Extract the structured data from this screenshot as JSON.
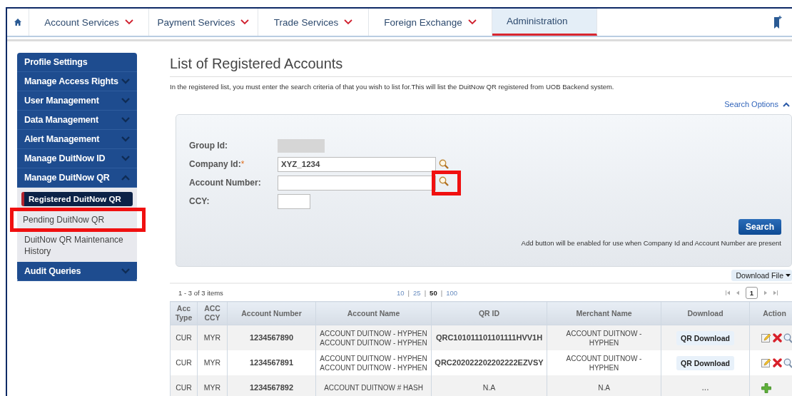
{
  "nav": {
    "items": [
      {
        "label": "Account Services",
        "has_menu": true,
        "selected": false
      },
      {
        "label": "Payment Services",
        "has_menu": true,
        "selected": false
      },
      {
        "label": "Trade Services",
        "has_menu": true,
        "selected": false
      },
      {
        "label": "Foreign Exchange",
        "has_menu": true,
        "selected": false
      },
      {
        "label": "Administration",
        "has_menu": false,
        "selected": true
      }
    ]
  },
  "sidebar": {
    "items": [
      {
        "label": "Profile Settings",
        "kind": "link"
      },
      {
        "label": "Manage Access Rights",
        "kind": "group"
      },
      {
        "label": "User Management",
        "kind": "group"
      },
      {
        "label": "Data Management",
        "kind": "group"
      },
      {
        "label": "Alert Management",
        "kind": "group"
      },
      {
        "label": "Manage DuitNow ID",
        "kind": "group"
      },
      {
        "label": "Manage DuitNow QR",
        "kind": "group",
        "expanded": true,
        "children": [
          {
            "label": "Registered DuitNow QR",
            "selected": true,
            "highlighted": false
          },
          {
            "label": "Pending DuitNow QR",
            "selected": false,
            "highlighted": true
          },
          {
            "label": "DuitNow QR Maintenance History",
            "selected": false,
            "highlighted": false
          }
        ]
      },
      {
        "label": "Audit Queries",
        "kind": "group"
      }
    ]
  },
  "page": {
    "title": "List of Registered Accounts",
    "description": "In the registered list, you must enter the search criteria of that you wish to list for.This will list the DuitNow QR registered from UOB Backend system.",
    "search_options": {
      "label": "Search Options",
      "expanded": true
    }
  },
  "search_form": {
    "fields": [
      {
        "label": "Group Id:",
        "kind": "locked"
      },
      {
        "label": "Company Id:",
        "required": true,
        "kind": "text",
        "value": "XYZ_1234",
        "lookup": {
          "highlighted": false
        }
      },
      {
        "label": "Account Number:",
        "kind": "text",
        "lookup": {
          "highlighted": true
        }
      },
      {
        "label": "CCY:",
        "kind": "short"
      }
    ],
    "required_mark": "*",
    "search_button": "Search",
    "note": "Add button will be enabled for use when Company Id and Account Number are present"
  },
  "download_file": "Download File",
  "pagination": {
    "summary": "1 - 3 of 3 items",
    "separator": "|",
    "page_sizes": [
      {
        "label": "10",
        "selected": false
      },
      {
        "label": "25",
        "selected": false
      },
      {
        "label": "50",
        "selected": true
      },
      {
        "label": "100",
        "selected": false
      }
    ],
    "pages": [
      {
        "label": "1",
        "selected": true
      }
    ]
  },
  "table": {
    "columns": [
      [
        "Acc",
        "Type"
      ],
      [
        "ACC",
        "CCY"
      ],
      [
        "Account Number"
      ],
      [
        "Account Name"
      ],
      [
        "QR ID"
      ],
      [
        "Merchant Name"
      ],
      [
        "Download"
      ],
      [
        "Action"
      ]
    ],
    "rows": [
      {
        "acc_type": "CUR",
        "acc_ccy": "MYR",
        "account_number": "1234567890",
        "account_name": [
          "ACCOUNT DUITNOW - HYPHEN",
          "ACCOUNT DUITNOW - HYPHEN"
        ],
        "qr_id": "QRC101011101101111HVV1H",
        "merchant_name": [
          "ACCOUNT DUITNOW -",
          "HYPHEN"
        ],
        "download": {
          "kind": "button",
          "label": "QR Download"
        },
        "actions": [
          {
            "kind": "edit"
          },
          {
            "kind": "delete"
          },
          {
            "kind": "view"
          }
        ]
      },
      {
        "acc_type": "CUR",
        "acc_ccy": "MYR",
        "account_number": "1234567891",
        "account_name": [
          "ACCOUNT DUITNOW - HYPHEN",
          "ACCOUNT DUITNOW - HYPHEN"
        ],
        "qr_id": "QRC202022202202222EZVSY",
        "merchant_name": [
          "ACCOUNT DUITNOW -",
          "HYPHEN"
        ],
        "download": {
          "kind": "button",
          "label": "QR Download"
        },
        "actions": [
          {
            "kind": "edit"
          },
          {
            "kind": "delete"
          },
          {
            "kind": "view"
          }
        ]
      },
      {
        "acc_type": "CUR",
        "acc_ccy": "MYR",
        "account_number": "1234567892",
        "account_name": [
          "ACCOUNT DUITNOW # HASH"
        ],
        "qr_id": "N.A",
        "merchant_name": [
          "N.A"
        ],
        "download": {
          "kind": "text",
          "label": "..."
        },
        "actions": [
          {
            "kind": "add"
          }
        ]
      }
    ]
  }
}
